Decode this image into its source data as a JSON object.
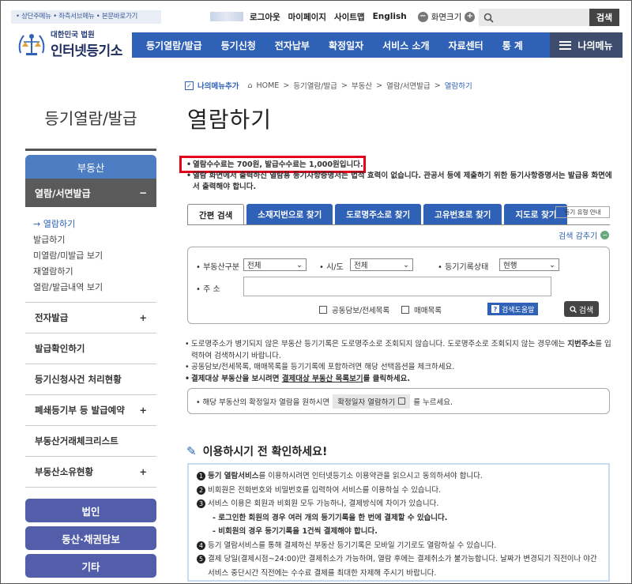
{
  "skip_links": "• 상단주메뉴 • 좌측서브메뉴 • 본문바로가기",
  "util": {
    "logout": "로그아웃",
    "mypage": "마이페이지",
    "sitemap": "사이트맵",
    "english": "English",
    "zoom": "화면크기",
    "minus": "−",
    "plus": "+"
  },
  "search": {
    "icon": "search-icon",
    "button": "검색"
  },
  "logo": {
    "line1": "대한민국 법원",
    "line2": "인터넷등기소"
  },
  "gnb": [
    "등기열람/발급",
    "등기신청",
    "전자납부",
    "확정일자",
    "서비스 소개",
    "자료센터",
    "통 계"
  ],
  "my_menu": "나의메뉴",
  "side": {
    "title": "등기열람/발급",
    "category": "부동산",
    "selected": "열람/서면발급",
    "selected_toggle": "−",
    "subitems": [
      "→ 열람하기",
      "발급하기",
      "미열람/미발급 보기",
      "재열람하기",
      "열람/발급내역 보기"
    ],
    "rows": [
      {
        "label": "전자발급",
        "toggle": "+"
      },
      {
        "label": "발급확인하기",
        "toggle": ""
      },
      {
        "label": "등기신청사건 처리현황",
        "toggle": ""
      },
      {
        "label": "폐쇄등기부 등 발급예약",
        "toggle": "+"
      },
      {
        "label": "부동산거래체크리스트",
        "toggle": ""
      },
      {
        "label": "부동산소유현황",
        "toggle": "+"
      }
    ],
    "pills": [
      "법인",
      "동산·채권담보",
      "기타"
    ]
  },
  "breadcrumb": {
    "fav": "나의메뉴추가",
    "items": [
      "HOME",
      "등기열람/발급",
      "부동산",
      "열람/서면발급"
    ],
    "current": "열람하기",
    "sep": ">"
  },
  "page_title": "열람하기",
  "notice": [
    "열람수수료는 700원, 발급수수료는 1,000원입니다.",
    "열람 화면에서 출력하신 열람용 등기사항증명서는 법적 효력이 없습니다. 관공서 등에 제출하기 위한 등기사항증명서는 발급용 화면에서 출력해야 합니다."
  ],
  "tabs": [
    "간편 검색",
    "소재지번으로 찾기",
    "도로명주소로 찾기",
    "고유번호로 찾기",
    "지도로 찾기"
  ],
  "type_guide": "등기 유형 안내",
  "collapse": {
    "label": "검색 감추기",
    "icon": "−"
  },
  "form": {
    "kind_label": "• 부동산구분",
    "kind_value": "전체",
    "region_label": "• 시/도",
    "region_value": "전체",
    "status_label": "• 등기기록상태",
    "status_value": "현행",
    "addr_label": "• 주 소",
    "cb1": "공동담보/전세목록",
    "cb2": "매매목록",
    "help": "검색도움말",
    "help_icon": "?",
    "search": "검색"
  },
  "tips": {
    "t1": "도로명주소가 병기되지 않은 부동산 등기기록은 도로명주소로 조회되지 않습니다. 도로명주소로 조회되지 않는 경우에는 ",
    "t1b": "지번주소",
    "t1c": "를 입력하여 검색하시기 바랍니다.",
    "t2": "공동담보/전세목록, 매매목록을 등기기록에 포함하려면 해당 선택옵션을 체크하세요.",
    "t3a": "결제대상 부동산을 보시려면 ",
    "t3link": "결제대상 부동산 목록보기",
    "t3b": "를 클릭하세요."
  },
  "confirm": {
    "pre": "• 해당 부동산의 확정일자 열람을 원하시면",
    "button": "확정일자 열람하기",
    "post": "를 누르세요."
  },
  "check_title": "이용하시기 전 확인하세요!",
  "guide": [
    {
      "n": "1",
      "b": "등기 열람서비스",
      "t": "를 이용하시려면 인터넷등기소 이용약관을 읽으시고 동의하셔야 합니다."
    },
    {
      "n": "2",
      "b": "",
      "t": "비회원은 전화번호와 비밀번호를 입력하여 서비스를 이용하실 수 있습니다."
    },
    {
      "n": "3",
      "b": "",
      "t": "서비스 이용은 회원과 비회원 모두 가능하나, 결제방식에 차이가 있습니다."
    },
    {
      "n": "4",
      "b": "",
      "t": "등기 열람서비스를 통해 결제하신 부동산 등기기록은 모바일 기기로도 열람하실 수 있습니다."
    },
    {
      "n": "5",
      "b": "",
      "t": "결제 당일(결제시점~24:00)만 결제취소가 가능하며, 열람 후에는 결제취소가 불가능합니다. 날짜가 변경되기 직전이나 야간 서비스 중단시간 직전에는 수수료 결제를 최대한 자제해 주시기 바랍니다."
    }
  ],
  "guide_dash": [
    "- 로그인한 회원의 경우 여러 개의 등기기록을 한 번에 결제할 수 있습니다.",
    "- 비회원의 경우 등기기록을 1건씩 결제해야 합니다."
  ]
}
